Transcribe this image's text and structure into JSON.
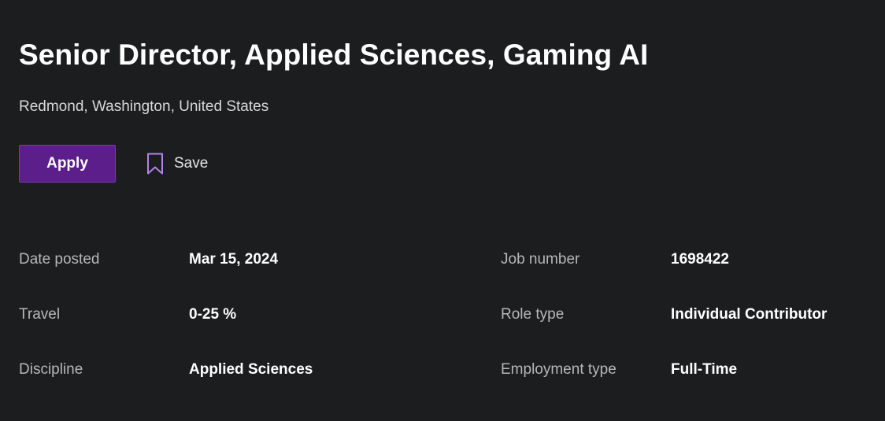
{
  "job": {
    "title": "Senior Director, Applied Sciences, Gaming AI",
    "location": "Redmond, Washington, United States"
  },
  "actions": {
    "apply_label": "Apply",
    "save_label": "Save",
    "save_icon": "bookmark-icon"
  },
  "colors": {
    "background": "#1b1d1f",
    "apply_button": "#5b1e8a",
    "accent_icon": "#b583e6"
  },
  "details": [
    {
      "label": "Date posted",
      "value": "Mar 15, 2024"
    },
    {
      "label": "Job number",
      "value": "1698422"
    },
    {
      "label": "Travel",
      "value": "0-25 %"
    },
    {
      "label": "Role type",
      "value": "Individual Contributor"
    },
    {
      "label": "Discipline",
      "value": "Applied Sciences"
    },
    {
      "label": "Employment type",
      "value": "Full-Time"
    }
  ]
}
